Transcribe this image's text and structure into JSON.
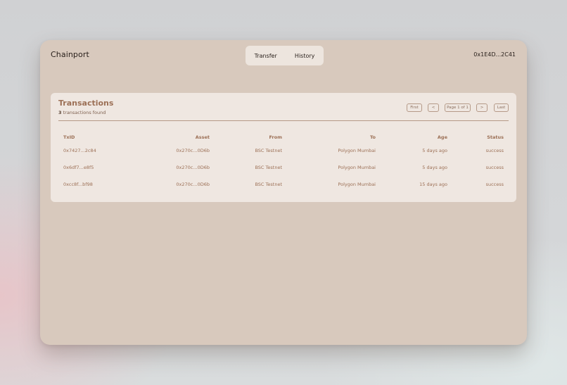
{
  "header": {
    "brand": "Chainport",
    "tabs": [
      "Transfer",
      "History"
    ],
    "wallet": "0x1E4D...2C41"
  },
  "transactions": {
    "title": "Transactions",
    "count": "3",
    "count_suffix": " transactions found",
    "pager": {
      "first": "First",
      "prev": "<",
      "page": "Page 1 of 1",
      "next": ">",
      "last": "Last"
    },
    "columns": [
      "TxID",
      "Asset",
      "From",
      "To",
      "Age",
      "Status"
    ],
    "rows": [
      [
        "0x7427...2c84",
        "0x270c...0D6b",
        "BSC Testnet",
        "Polygon Mumbai",
        "5 days ago",
        "success"
      ],
      [
        "0x6df7...e8f5",
        "0x270c...0D6b",
        "BSC Testnet",
        "Polygon Mumbai",
        "5 days ago",
        "success"
      ],
      [
        "0xcc8f...bf98",
        "0x270c...0D6b",
        "BSC Testnet",
        "Polygon Mumbai",
        "15 days ago",
        "success"
      ]
    ]
  }
}
